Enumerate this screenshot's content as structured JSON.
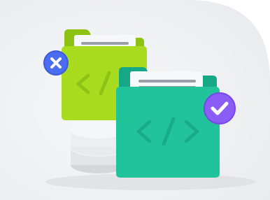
{
  "illustration": {
    "theme": "code file review",
    "colors": {
      "background_card": "#f4f5f7",
      "green_folder": "#a9dc1f",
      "green_folder_dark": "#8dc112",
      "teal_folder": "#21c49a",
      "teal_folder_dark": "#14a886",
      "paper": "#f7f8fa",
      "paper_line": "#9aa0a8",
      "reject_badge": "#4a6cf0",
      "approve_badge": "#8b5cf6",
      "disc_stack": "#e7e8eb"
    },
    "icons": [
      "code-brackets-icon",
      "close-icon",
      "check-icon"
    ]
  }
}
